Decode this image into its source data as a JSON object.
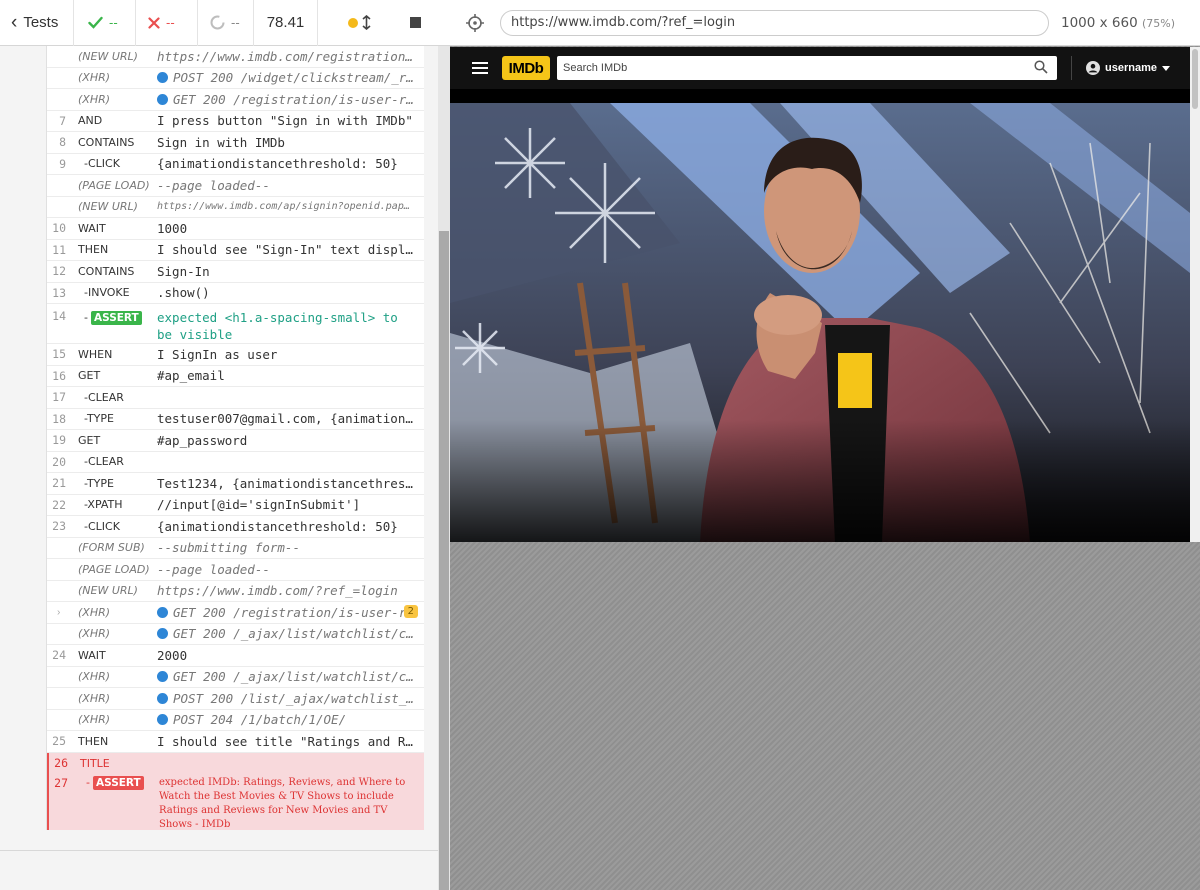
{
  "runner": {
    "tests_label": "Tests",
    "stats": {
      "passed": "--",
      "failed": "--",
      "pending": "--",
      "duration": "78.41"
    }
  },
  "commands": [
    {
      "num": "",
      "cmd": "(NEW URL)",
      "msg": "https://www.imdb.com/registration/s…",
      "kind": "event"
    },
    {
      "num": "",
      "cmd": "(XHR)",
      "msg": "POST 200 /widget/clickstream/_rvi",
      "kind": "event",
      "dot": true
    },
    {
      "num": "",
      "cmd": "(XHR)",
      "msg": "GET 200 /registration/is-user-rec…",
      "kind": "event",
      "dot": true
    },
    {
      "num": "7",
      "cmd": "AND",
      "msg": "I press button \"Sign in with IMDb\"",
      "kind": "step"
    },
    {
      "num": "8",
      "cmd": "CONTAINS",
      "msg": "Sign in with IMDb",
      "kind": "cmd"
    },
    {
      "num": "9",
      "cmd": "-CLICK",
      "msg": "{animationdistancethreshold: 50}",
      "kind": "child"
    },
    {
      "num": "",
      "cmd": "(PAGE LOAD)",
      "msg": "--page loaded--",
      "kind": "event"
    },
    {
      "num": "",
      "cmd": "(NEW URL)",
      "msg": "https://www.imdb.com/ap/signin?openid.pap…",
      "kind": "event small"
    },
    {
      "num": "10",
      "cmd": "WAIT",
      "msg": "1000",
      "kind": "cmd"
    },
    {
      "num": "11",
      "cmd": "THEN",
      "msg": "I should see \"Sign-In\" text display…",
      "kind": "step"
    },
    {
      "num": "12",
      "cmd": "CONTAINS",
      "msg": "Sign-In",
      "kind": "cmd"
    },
    {
      "num": "13",
      "cmd": "-INVOKE",
      "msg": ".show()",
      "kind": "child"
    },
    {
      "num": "14",
      "cmd": "-ASSERT",
      "msg": "expected <h1.a-spacing-small> to be visible",
      "kind": "assert-pass"
    },
    {
      "num": "15",
      "cmd": "WHEN",
      "msg": "I SignIn as user",
      "kind": "step"
    },
    {
      "num": "16",
      "cmd": "GET",
      "msg": "#ap_email",
      "kind": "cmd"
    },
    {
      "num": "17",
      "cmd": "-CLEAR",
      "msg": "",
      "kind": "child"
    },
    {
      "num": "18",
      "cmd": "-TYPE",
      "msg": "testuser007@gmail.com, {animationdi…",
      "kind": "child"
    },
    {
      "num": "19",
      "cmd": "GET",
      "msg": "#ap_password",
      "kind": "cmd"
    },
    {
      "num": "20",
      "cmd": "-CLEAR",
      "msg": "",
      "kind": "child"
    },
    {
      "num": "21",
      "cmd": "-TYPE",
      "msg": "Test1234, {animationdistancethresho…",
      "kind": "child"
    },
    {
      "num": "22",
      "cmd": "-XPATH",
      "msg": "//input[@id='signInSubmit']",
      "kind": "child"
    },
    {
      "num": "23",
      "cmd": "-CLICK",
      "msg": "{animationdistancethreshold: 50}",
      "kind": "child"
    },
    {
      "num": "",
      "cmd": "(FORM SUB)",
      "msg": "--submitting form--",
      "kind": "event"
    },
    {
      "num": "",
      "cmd": "(PAGE LOAD)",
      "msg": "--page loaded--",
      "kind": "event"
    },
    {
      "num": "",
      "cmd": "(NEW URL)",
      "msg": "https://www.imdb.com/?ref_=login",
      "kind": "event"
    },
    {
      "num": "",
      "cmd": "(XHR)",
      "msg": "GET 200 /registration/is-user-r…",
      "kind": "event",
      "dot": true,
      "arrow": true,
      "badge": "2"
    },
    {
      "num": "",
      "cmd": "(XHR)",
      "msg": "GET 200 /_ajax/list/watchlist/cou…",
      "kind": "event",
      "dot": true
    },
    {
      "num": "24",
      "cmd": "WAIT",
      "msg": "2000",
      "kind": "cmd"
    },
    {
      "num": "",
      "cmd": "(XHR)",
      "msg": "GET 200 /_ajax/list/watchlist/cou…",
      "kind": "event",
      "dot": true
    },
    {
      "num": "",
      "cmd": "(XHR)",
      "msg": "POST 200 /list/_ajax/watchlist_has",
      "kind": "event",
      "dot": true
    },
    {
      "num": "",
      "cmd": "(XHR)",
      "msg": "POST 204 /1/batch/1/OE/",
      "kind": "event",
      "dot": true
    },
    {
      "num": "25",
      "cmd": "THEN",
      "msg": "I should see title \"Ratings and Rev…",
      "kind": "step"
    }
  ],
  "failed": {
    "title_num": "26",
    "title_cmd": "TITLE",
    "assert_num": "27",
    "assert_cmd": "-ASSERT",
    "assert_msg": "expected IMDb: Ratings, Reviews, and Where to Watch the Best Movies & TV Shows to include Ratings and Reviews for New Movies and TV Shows - IMDb"
  },
  "aut": {
    "url": "https://www.imdb.com/?ref_=login",
    "viewport": "1000 x 660",
    "scale": "(75%)",
    "site": {
      "logo": "IMDb",
      "search_placeholder": "Search IMDb",
      "username": "username"
    }
  },
  "colors": {
    "pass": "#3ab54a",
    "fail": "#e94f4f",
    "pending_dot": "#f4b91a",
    "imdb_yellow": "#f5c518",
    "xhr_dot": "#2e86d6"
  },
  "icons": [
    "chevron-left-icon",
    "check-icon",
    "x-icon",
    "circle-notch-icon",
    "stop-icon",
    "resize-icon",
    "crosshair-icon",
    "search-icon",
    "user-icon",
    "caret-down-icon"
  ]
}
